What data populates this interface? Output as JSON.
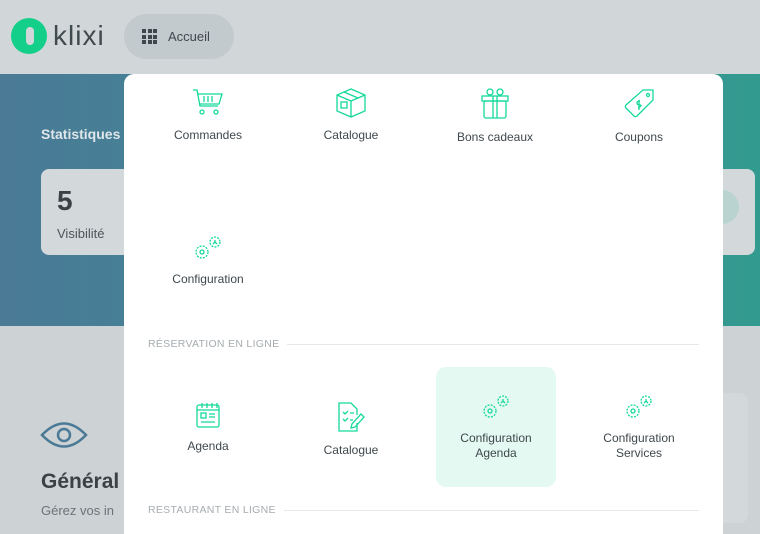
{
  "header": {
    "logo_text": "klixi",
    "home_button": "Accueil"
  },
  "background": {
    "stats_title": "Statistiques",
    "stat_value": "5",
    "stat_label": "Visibilité",
    "section_title": "Général",
    "section_desc": "Gérez vos in"
  },
  "menu": {
    "top_items": [
      {
        "label": "Commandes",
        "icon": "cart-icon"
      },
      {
        "label": "Catalogue",
        "icon": "box-icon"
      },
      {
        "label": "Bons cadeaux",
        "icon": "gift-icon"
      },
      {
        "label": "Coupons",
        "icon": "tag-icon"
      },
      {
        "label": "Configuration",
        "icon": "gears-icon"
      }
    ],
    "sections": [
      {
        "title": "RÉSERVATION EN LIGNE",
        "items": [
          {
            "label": "Agenda",
            "icon": "calendar-icon"
          },
          {
            "label": "Catalogue",
            "icon": "checklist-icon"
          },
          {
            "label": "Configuration Agenda",
            "icon": "gears-icon",
            "active": true
          },
          {
            "label": "Configuration Services",
            "icon": "gears-icon"
          }
        ]
      },
      {
        "title": "RESTAURANT EN LIGNE"
      }
    ]
  },
  "colors": {
    "accent": "#14d99a",
    "active_bg": "#e3f9f1",
    "text": "#3f484d"
  }
}
